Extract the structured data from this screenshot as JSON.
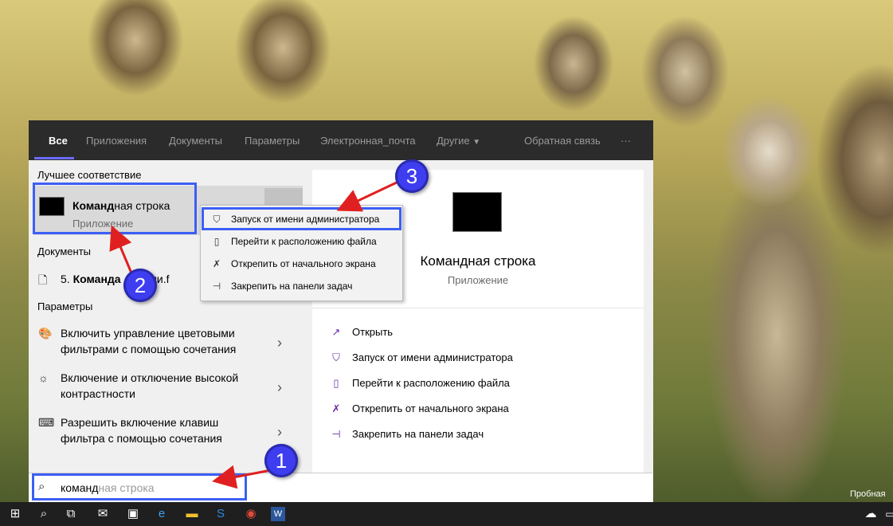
{
  "tabs": [
    {
      "label": "Все"
    },
    {
      "label": "Приложения"
    },
    {
      "label": "Документы"
    },
    {
      "label": "Параметры"
    },
    {
      "label": "Электронная_почта"
    },
    {
      "label": "Другие"
    },
    {
      "label": "Обратная связь"
    },
    {
      "label": "···"
    }
  ],
  "left": {
    "best_match_header": "Лучшее соответствие",
    "best_match": {
      "title_bold": "Команд",
      "title_rest": "ная строка",
      "subtitle": "Приложение"
    },
    "documents_header": "Документы",
    "document_item": {
      "prefix": "5. ",
      "bold": "Команда",
      "rest": " ... Цели.f"
    },
    "settings_header": "Параметры",
    "settings": [
      {
        "line1": "Включить управление цветовыми",
        "line2": "фильтрами с помощью сочетания",
        "icon": "palette-icon"
      },
      {
        "line1": "Включение и отключение высокой",
        "line2": "контрастности",
        "icon": "sun-icon"
      },
      {
        "line1": "Разрешить включение клавиш",
        "line2": "фильтра с помощью сочетания",
        "icon": "keyboard-icon"
      }
    ]
  },
  "context_menu": [
    {
      "label": "Запуск от имени администратора",
      "icon": "shield-icon"
    },
    {
      "label": "Перейти к расположению файла",
      "icon": "folder-icon"
    },
    {
      "label": "Открепить от начального экрана",
      "icon": "unpin-icon"
    },
    {
      "label": "Закрепить на панели задач",
      "icon": "pin-icon"
    }
  ],
  "preview": {
    "title": "Командная строка",
    "subtitle": "Приложение",
    "actions": [
      {
        "label": "Открыть",
        "icon": "open-icon"
      },
      {
        "label": "Запуск от имени администратора",
        "icon": "shield-icon"
      },
      {
        "label": "Перейти к расположению файла",
        "icon": "folder-icon"
      },
      {
        "label": "Открепить от начального экрана",
        "icon": "unpin-icon"
      },
      {
        "label": "Закрепить на панели задач",
        "icon": "pin-icon"
      }
    ]
  },
  "search": {
    "typed": "команд",
    "suggestion": "ная строка"
  },
  "annotations": {
    "one": "1",
    "two": "2",
    "three": "3"
  },
  "desktop": {
    "watermark": "Пробная"
  },
  "colors": {
    "accent": "#6b6bff",
    "highlight": "#3c5ff5",
    "badge": "#3e3ef0",
    "arrow": "#e02020",
    "icon_purple": "#6b2fa5"
  }
}
